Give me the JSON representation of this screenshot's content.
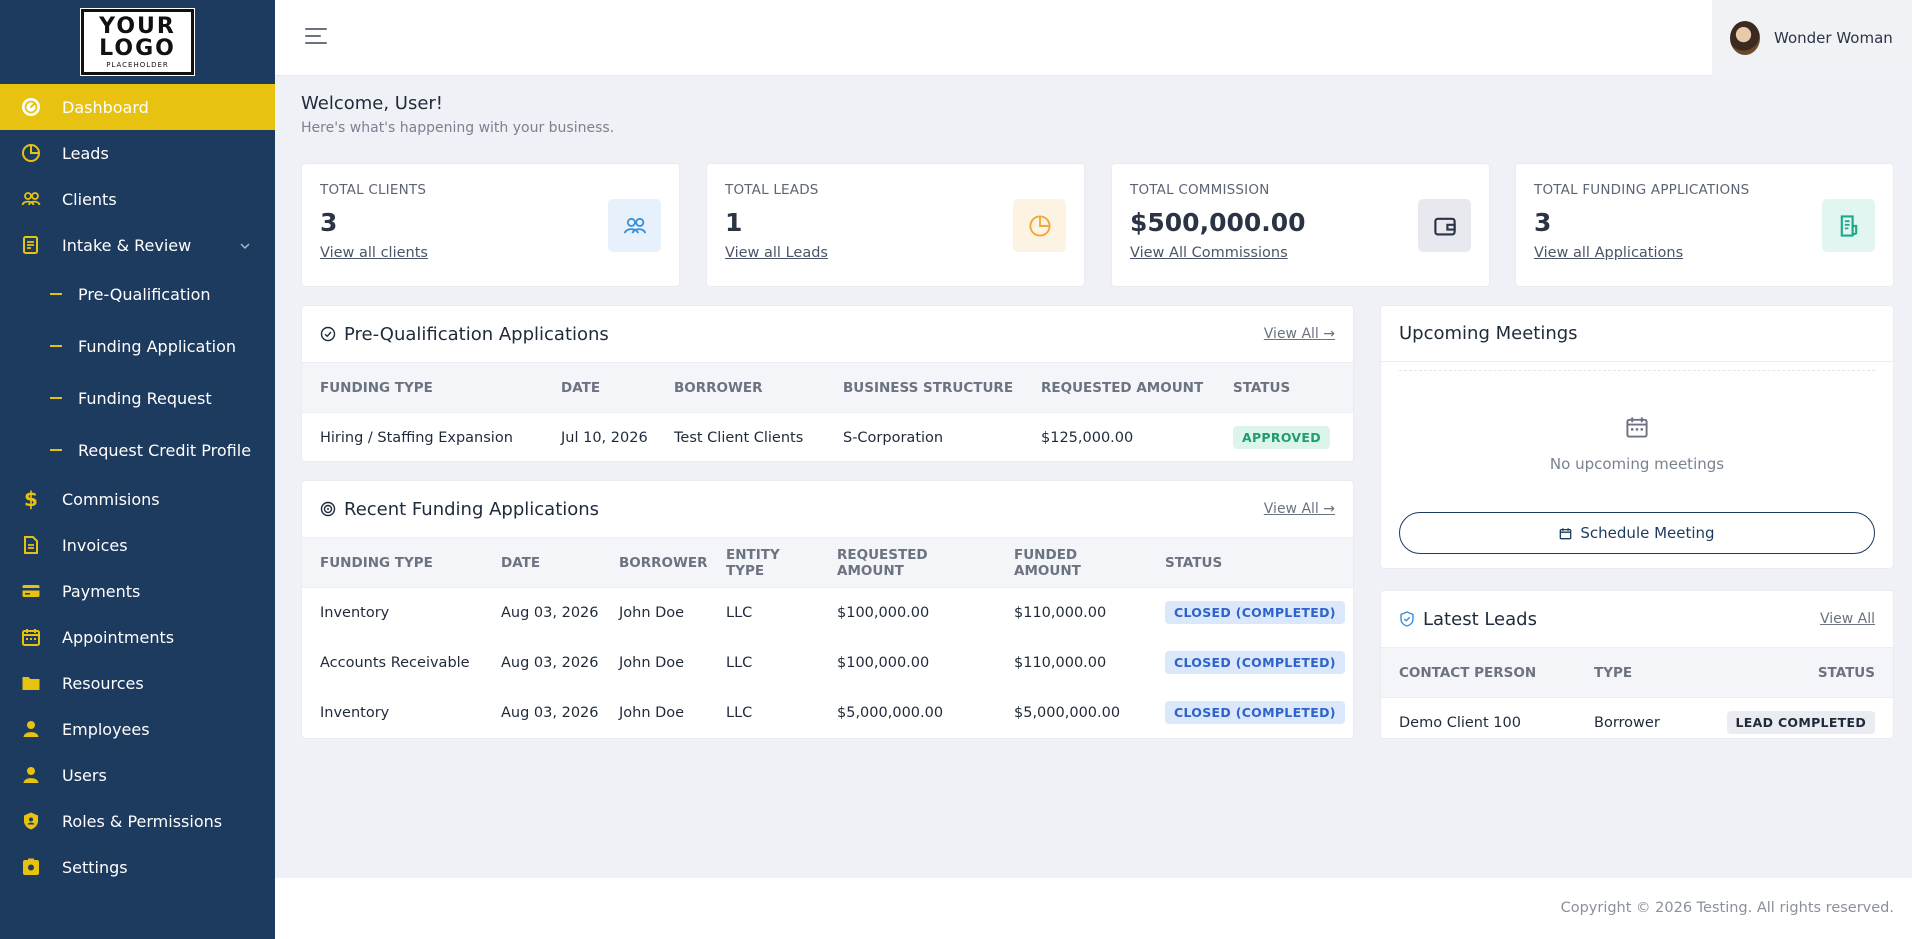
{
  "brand": {
    "logo_line1": "YOUR",
    "logo_line2": "LOGO",
    "logo_line3": "PLACEHOLDER"
  },
  "colors": {
    "sidebar": "#1d3a5f",
    "accent": "#e7c211",
    "background": "#f0f1f6"
  },
  "sidebar": {
    "items": [
      {
        "label": "Dashboard",
        "icon": "dashboard-gauge-icon",
        "active": true
      },
      {
        "label": "Leads",
        "icon": "pie-chart-icon"
      },
      {
        "label": "Clients",
        "icon": "users-icon"
      },
      {
        "label": "Intake & Review",
        "icon": "clipboard-icon",
        "expanded": true
      },
      {
        "label": "Commisions",
        "icon": "dollar-icon"
      },
      {
        "label": "Invoices",
        "icon": "document-icon"
      },
      {
        "label": "Payments",
        "icon": "credit-card-icon"
      },
      {
        "label": "Appointments",
        "icon": "calendar-icon"
      },
      {
        "label": "Resources",
        "icon": "folder-icon"
      },
      {
        "label": "Employees",
        "icon": "user-icon"
      },
      {
        "label": "Users",
        "icon": "user-icon"
      },
      {
        "label": "Roles & Permissions",
        "icon": "shield-icon"
      },
      {
        "label": "Settings",
        "icon": "settings-icon"
      }
    ],
    "sub_items": [
      {
        "label": "Pre-Qualification"
      },
      {
        "label": "Funding Application"
      },
      {
        "label": "Funding Request"
      },
      {
        "label": "Request Credit Profile"
      }
    ]
  },
  "topbar": {
    "user_name": "Wonder Woman"
  },
  "welcome": {
    "title": "Welcome, User!",
    "subtitle": "Here's what's happening with your business."
  },
  "stats": [
    {
      "label": "TOTAL CLIENTS",
      "value": "3",
      "link": "View all clients",
      "icon": "users-icon",
      "color": "#3b8fd9"
    },
    {
      "label": "TOTAL LEADS",
      "value": "1",
      "link": "View all Leads",
      "icon": "pie-chart-icon",
      "color": "#f0a93a"
    },
    {
      "label": "TOTAL COMMISSION",
      "value": "$500,000.00",
      "link": "View All Commissions",
      "icon": "wallet-icon",
      "color": "#2b3445"
    },
    {
      "label": "TOTAL FUNDING APPLICATIONS",
      "value": "3",
      "link": "View all Applications",
      "icon": "document-icon",
      "color": "#1fa88a"
    }
  ],
  "prequal": {
    "title": "Pre-Qualification Applications",
    "view_all": "View All →",
    "headers": [
      "FUNDING TYPE",
      "DATE",
      "BORROWER",
      "BUSINESS STRUCTURE",
      "REQUESTED AMOUNT",
      "STATUS"
    ],
    "rows": [
      [
        "Hiring / Staffing Expansion",
        "Jul 10, 2026",
        "Test Client Clients",
        "S-Corporation",
        "$125,000.00",
        "APPROVED"
      ]
    ]
  },
  "funding": {
    "title": "Recent Funding Applications",
    "view_all": "View All →",
    "headers": [
      "FUNDING TYPE",
      "DATE",
      "BORROWER",
      "ENTITY TYPE",
      "REQUESTED AMOUNT",
      "FUNDED AMOUNT",
      "STATUS"
    ],
    "rows": [
      [
        "Inventory",
        "Aug 03, 2026",
        "John Doe",
        "LLC",
        "$100,000.00",
        "$110,000.00",
        "CLOSED (COMPLETED)"
      ],
      [
        "Accounts Receivable",
        "Aug 03, 2026",
        "John Doe",
        "LLC",
        "$100,000.00",
        "$110,000.00",
        "CLOSED (COMPLETED)"
      ],
      [
        "Inventory",
        "Aug 03, 2026",
        "John Doe",
        "LLC",
        "$5,000,000.00",
        "$5,000,000.00",
        "CLOSED (COMPLETED)"
      ]
    ]
  },
  "meetings": {
    "title": "Upcoming Meetings",
    "empty": "No upcoming meetings",
    "button": "Schedule Meeting"
  },
  "leads": {
    "title": "Latest Leads",
    "view_all": "View All",
    "headers": [
      "CONTACT PERSON",
      "TYPE",
      "STATUS"
    ],
    "rows": [
      [
        "Demo Client 100",
        "Borrower",
        "LEAD COMPLETED"
      ]
    ]
  },
  "footer": {
    "copyright": "Copyright © 2026 Testing. All rights reserved."
  }
}
